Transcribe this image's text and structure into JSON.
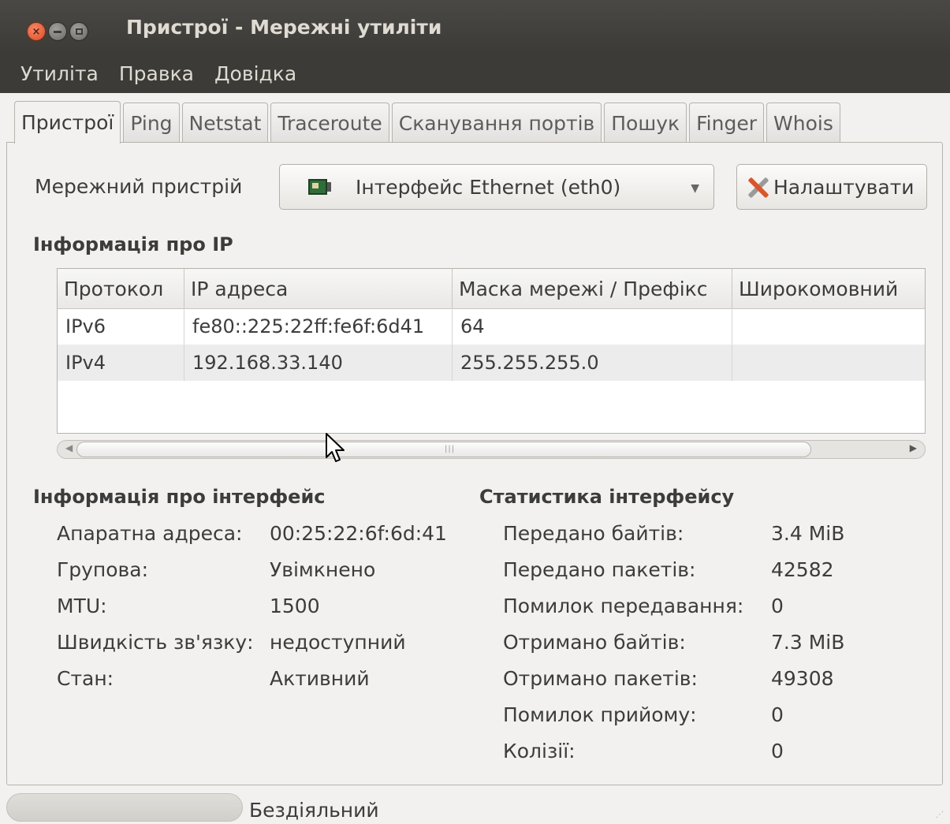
{
  "window": {
    "title": "Пристрої - Мережні утиліти"
  },
  "menubar": {
    "items": [
      "Утиліта",
      "Правка",
      "Довідка"
    ]
  },
  "tabs": [
    "Пристрої",
    "Ping",
    "Netstat",
    "Traceroute",
    "Сканування портів",
    "Пошук",
    "Finger",
    "Whois"
  ],
  "device": {
    "label": "Мережний пристрій",
    "selected": "Інтерфейс Ethernet (eth0)",
    "icon": "network-card-icon",
    "configure_label": "Налаштувати"
  },
  "ip_info": {
    "heading": "Інформація про IP",
    "columns": [
      "Протокол",
      "IP адреса",
      "Маска мережі / Префікс",
      "Широкомовний"
    ],
    "rows": [
      [
        "IPv6",
        "fe80::225:22ff:fe6f:6d41",
        "64",
        ""
      ],
      [
        "IPv4",
        "192.168.33.140",
        "255.255.255.0",
        ""
      ]
    ]
  },
  "interface_info": {
    "heading": "Інформація про інтерфейс",
    "items": [
      {
        "label": "Апаратна адреса:",
        "value": "00:25:22:6f:6d:41"
      },
      {
        "label": "Групова:",
        "value": "Увімкнено"
      },
      {
        "label": "MTU:",
        "value": "1500"
      },
      {
        "label": "Швидкість зв'язку:",
        "value": "недоступний"
      },
      {
        "label": "Стан:",
        "value": "Активний"
      }
    ]
  },
  "interface_stats": {
    "heading": "Статистика інтерфейсу",
    "items": [
      {
        "label": "Передано байтів:",
        "value": "3.4 MiB"
      },
      {
        "label": "Передано пакетів:",
        "value": "42582"
      },
      {
        "label": "Помилок передавання:",
        "value": "0"
      },
      {
        "label": "Отримано байтів:",
        "value": "7.3 MiB"
      },
      {
        "label": "Отримано пакетів:",
        "value": "49308"
      },
      {
        "label": "Помилок прийому:",
        "value": "0"
      },
      {
        "label": "Колізії:",
        "value": "0"
      }
    ]
  },
  "statusbar": {
    "text": "Бездіяльний"
  }
}
